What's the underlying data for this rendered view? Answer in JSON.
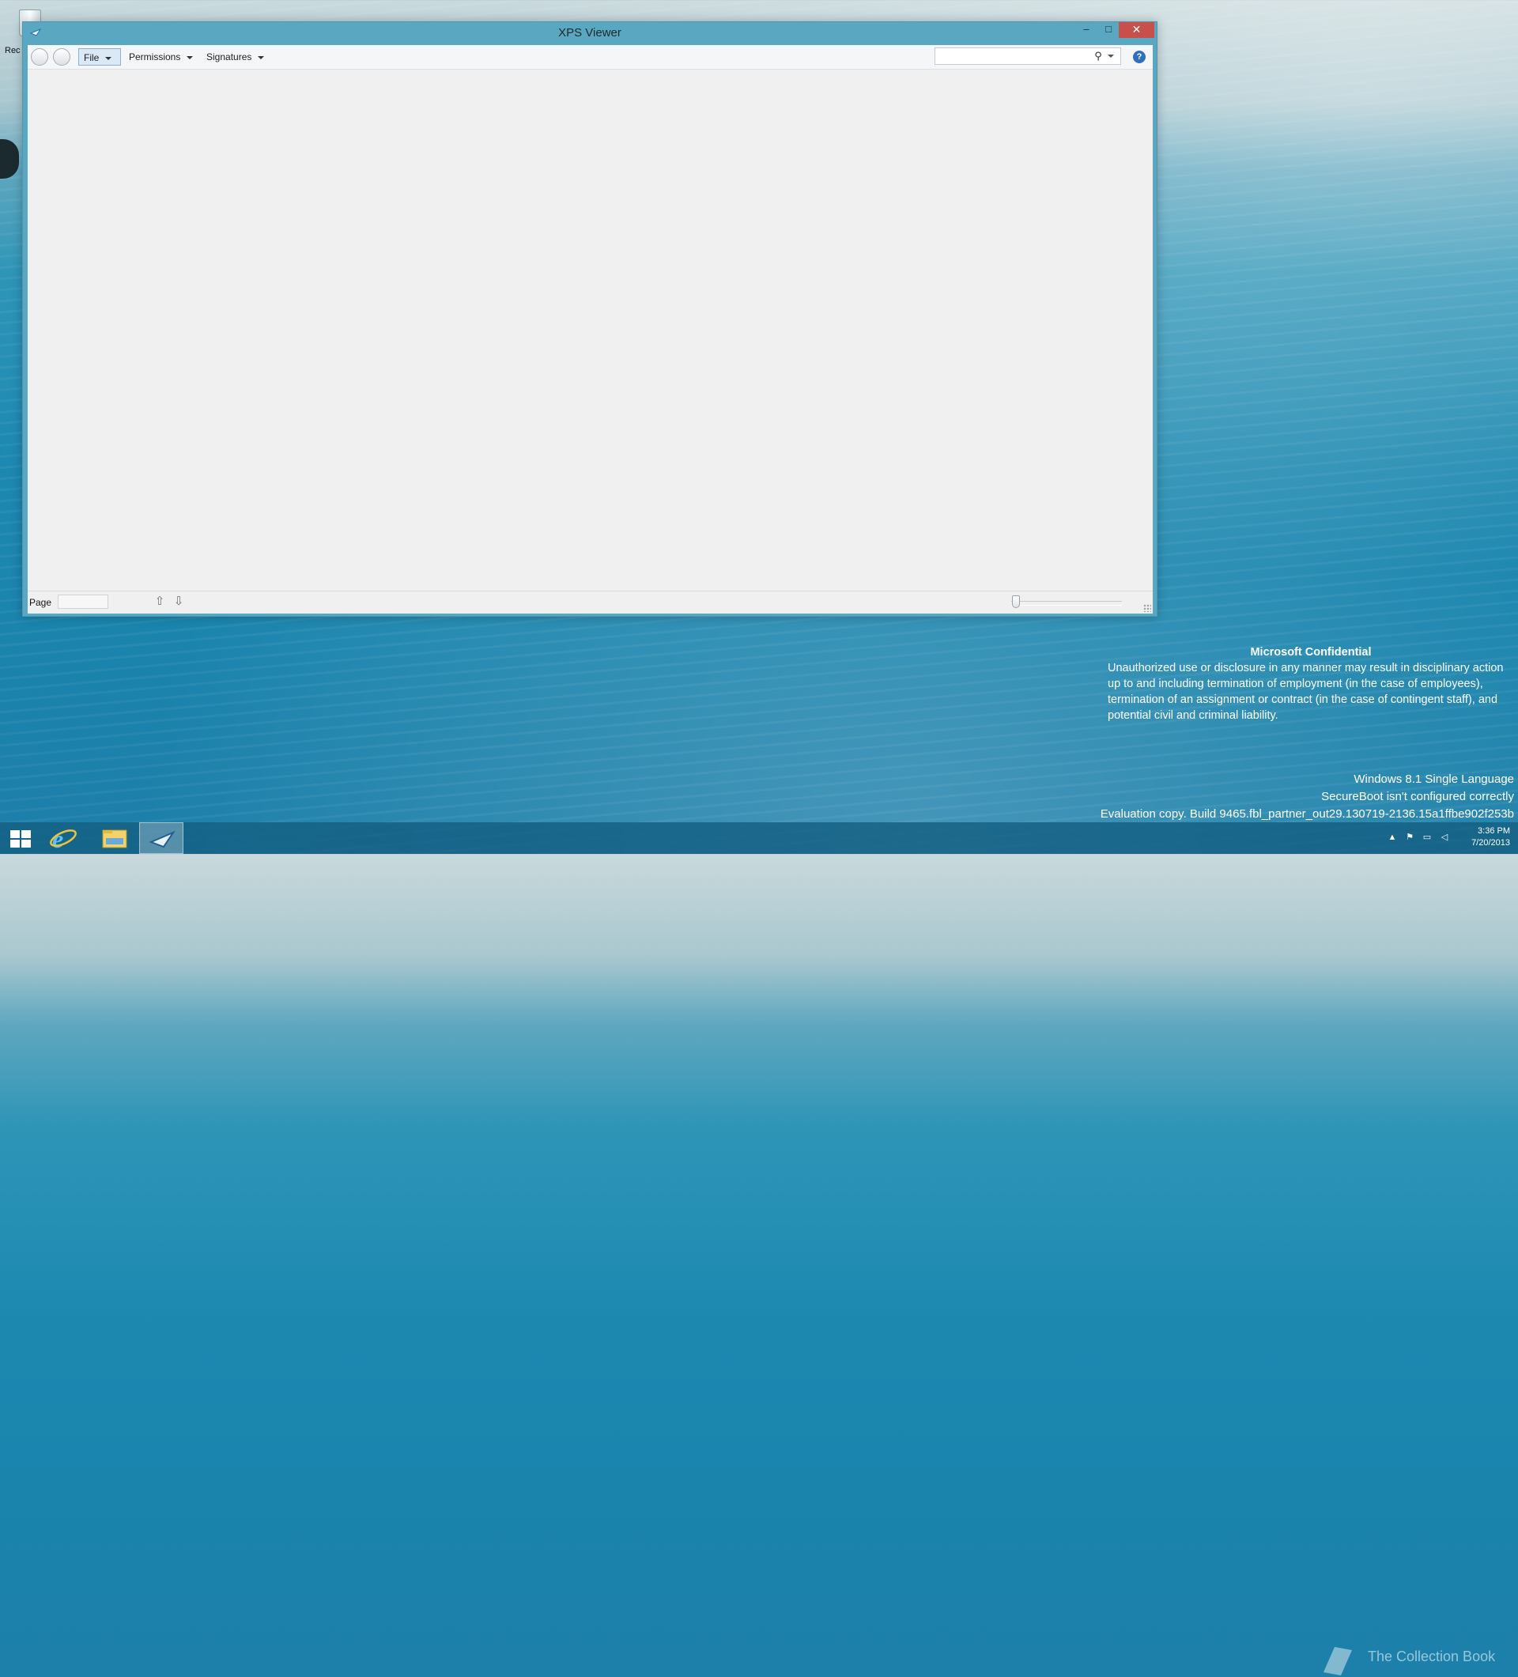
{
  "desktop": {
    "recycle_bin_label": "Rec",
    "confidential": {
      "title": "Microsoft Confidential",
      "body": "Unauthorized use or disclosure in any manner may result in disciplinary action up to and including termination of employment (in the case of employees), termination of an assignment or contract (in the case of contingent staff), and potential civil and criminal liability."
    },
    "build_info": {
      "edition": "Windows 8.1 Single Language",
      "secureboot": "SecureBoot isn't configured correctly",
      "build": "Evaluation copy. Build 9465.fbl_partner_out29.130719-2136.15a1ffbe902f253b"
    },
    "watermark": "The Collection Book"
  },
  "window": {
    "title": "XPS Viewer",
    "controls": {
      "minimize": "–",
      "maximize": "□",
      "close": "✕"
    },
    "toolbar": {
      "menus": [
        "File",
        "Permissions",
        "Signatures"
      ],
      "search": {
        "value": "",
        "placeholder": ""
      },
      "help_icon": "?"
    },
    "statusbar": {
      "page_label": "Page",
      "page_value": "",
      "prev_icon": "⇧",
      "next_icon": "⇩"
    }
  },
  "taskbar": {
    "clock": {
      "time": "3:36 PM",
      "date": "7/20/2013"
    },
    "items": [
      "start",
      "internet-explorer",
      "file-explorer",
      "xps-viewer"
    ]
  },
  "colors": {
    "window_frame": "#5aa7c2",
    "close_button": "#c7504a",
    "taskbar": "#145f82"
  }
}
